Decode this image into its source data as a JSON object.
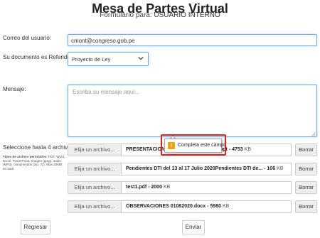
{
  "header": {
    "title": "Mesa de Partes Virtual",
    "subtitle_prefix": "Formulario para:",
    "subtitle_user": "USUARIO INTERNO"
  },
  "form": {
    "email_label": "Correo del usuario:",
    "email_value": "cmont@congreso.gob.pe",
    "referido_label": "Su documento es Referido a:",
    "referido_value": "Proyecto de Ley",
    "message_label": "Mensaje:",
    "message_placeholder": "Escriba su mensaje aqui...",
    "files_label": "Seleccione hasta 4 archivos",
    "allowed_title": "Tipos de archivo permitidos:",
    "allowed_text": "PDF, Word, Excel, PowerPoint, Imagen (jpeg), audio (MP3), comprimidos (zip, 7z). Max 20MB en total."
  },
  "files": [
    {
      "choose_label": "Elija un archivo...",
      "name": "PRESENTACION DE PROYECTOS 2020.ppt",
      "size": "- 4753",
      "unit": "KB",
      "delete_label": "Borrar"
    },
    {
      "choose_label": "Elija un archivo...",
      "name": "Pendientes DTI del 13 al 17 Julio 2020Pendientes DTI de...",
      "size": "- 106",
      "unit": "KB",
      "delete_label": "Borrar"
    },
    {
      "choose_label": "Elija un archivo...",
      "name": "test1.pdf",
      "size": "- 2000",
      "unit": "KB",
      "delete_label": "Borrar"
    },
    {
      "choose_label": "Elija un archivo...",
      "name": "OBSERVACIONES 01082020.docx",
      "size": "- 5980",
      "unit": "KB",
      "delete_label": "Borrar"
    }
  ],
  "tooltip": {
    "icon": "warning-icon",
    "icon_glyph": "!",
    "message": "Completa este campo",
    "icon_color": "#f0a30a",
    "highlight_color": "#e02020"
  },
  "actions": {
    "reset_label": "Regresar",
    "send_label": "Enviar"
  }
}
